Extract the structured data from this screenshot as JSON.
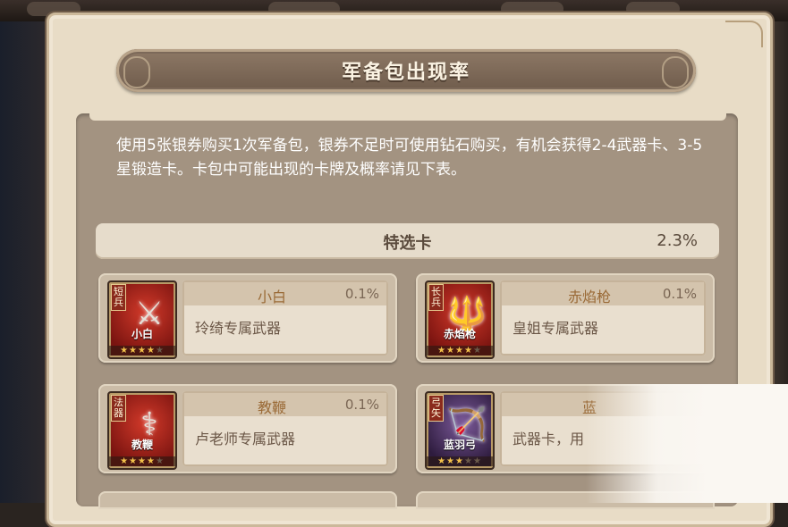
{
  "panel": {
    "title": "军备包出现率",
    "description": "使用5张银券购买1次军备包，银券不足时可使用钻石购买，有机会获得2-4武器卡、3-5星锻造卡。卡包中可能出现的卡牌及概率请见下表。"
  },
  "category": {
    "name": "特选卡",
    "rate": "2.3%"
  },
  "cards": [
    {
      "type": "短兵",
      "thumb_name": "小白",
      "name": "小白",
      "rate": "0.1%",
      "desc": "玲绮专属武器",
      "stars_filled": 4,
      "stars_total": 5,
      "glyph": "⚔",
      "theme": "red"
    },
    {
      "type": "长兵",
      "thumb_name": "赤焰枪",
      "name": "赤焰枪",
      "rate": "0.1%",
      "desc": "皇姐专属武器",
      "stars_filled": 4,
      "stars_total": 5,
      "glyph": "🔱",
      "theme": "red"
    },
    {
      "type": "法器",
      "thumb_name": "教鞭",
      "name": "教鞭",
      "rate": "0.1%",
      "desc": "卢老师专属武器",
      "stars_filled": 4,
      "stars_total": 5,
      "glyph": "⚕",
      "theme": "red"
    },
    {
      "type": "弓矢",
      "thumb_name": "蓝羽弓",
      "name": "蓝",
      "rate": "",
      "desc": "武器卡，用",
      "stars_filled": 3,
      "stars_total": 5,
      "glyph": "🏹",
      "theme": "purple"
    }
  ],
  "colors": {
    "panel_bg": "#e8dcc6",
    "well_bg": "#a39381",
    "banner": "#7d6a58",
    "name_text": "#9a6a36",
    "star": "#f2c14a"
  }
}
